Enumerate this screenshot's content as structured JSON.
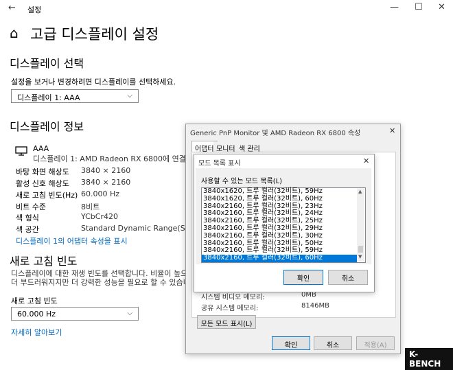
{
  "window": {
    "title": "설정",
    "back_glyph": "←",
    "minimize": "—",
    "maximize": "☐",
    "close": "✕"
  },
  "page": {
    "home_glyph": "⌂",
    "title": "고급 디스플레이 설정"
  },
  "display_select": {
    "heading": "디스플레이 선택",
    "description": "설정을 보거나 변경하려면 디스플레이를 선택하세요.",
    "selected": "디스플레이 1: AAA"
  },
  "display_info": {
    "heading": "디스플레이 정보",
    "monitor_name": "AAA",
    "monitor_sub": "디스플레이 1: AMD Radeon RX 6800에 연결됨",
    "rows": [
      {
        "label": "바탕 화면 해상도",
        "value": "3840 × 2160"
      },
      {
        "label": "활성 신호 해상도",
        "value": "3840 × 2160"
      },
      {
        "label": "새로 고침 빈도(Hz)",
        "value": "60.000 Hz"
      },
      {
        "label": "비트 수준",
        "value": "8비트"
      },
      {
        "label": "색 형식",
        "value": "YCbCr420"
      },
      {
        "label": "색 공간",
        "value": "Standard Dynamic Range(SDR)"
      }
    ],
    "adapter_link": "디스플레이 1의 어댑터 속성을 표시"
  },
  "refresh": {
    "heading": "새로 고침 빈도",
    "desc1": "디스플레이에 대한 재생 빈도를 선택합니다. 비율이 높으면 움",
    "desc2": "더 부드러워지지만 더 강력한 성능을 필요로 할 수 있습니다.",
    "label": "새로 고침 빈도",
    "selected": "60.000 Hz",
    "learn_more": "자세히 알아보기"
  },
  "props_dialog": {
    "title": "Generic PnP Monitor 및 AMD Radeon RX 6800 속성",
    "close": "✕",
    "tabs": [
      "어댑터",
      "모니터",
      "색 관리"
    ],
    "sys_video_label": "시스템 비디오 메모리:",
    "sys_video_value": "0MB",
    "shared_label": "공유 시스템 메모리:",
    "shared_value": "8146MB",
    "list_all_modes": "모든 모드 표시(L)",
    "ok": "확인",
    "cancel": "취소",
    "apply": "적용(A)"
  },
  "modes_dialog": {
    "title": "모드 목록 표시",
    "close": "✕",
    "list_label": "사용할 수 있는 모드 목록(L)",
    "modes": [
      "3840x1620, 트루 컬러(32비트), 59Hz",
      "3840x1620, 트루 컬러(32비트), 60Hz",
      "3840x2160, 트루 컬러(32비트), 23Hz",
      "3840x2160, 트루 컬러(32비트), 24Hz",
      "3840x2160, 트루 컬러(32비트), 25Hz",
      "3840x2160, 트루 컬러(32비트), 29Hz",
      "3840x2160, 트루 컬러(32비트), 30Hz",
      "3840x2160, 트루 컬러(32비트), 50Hz",
      "3840x2160, 트루 컬러(32비트), 59Hz",
      "3840x2160, 트루 컬러(32비트), 60Hz"
    ],
    "selected_index": 9,
    "ok": "확인",
    "cancel": "취소"
  },
  "watermark": "K-BENCH"
}
